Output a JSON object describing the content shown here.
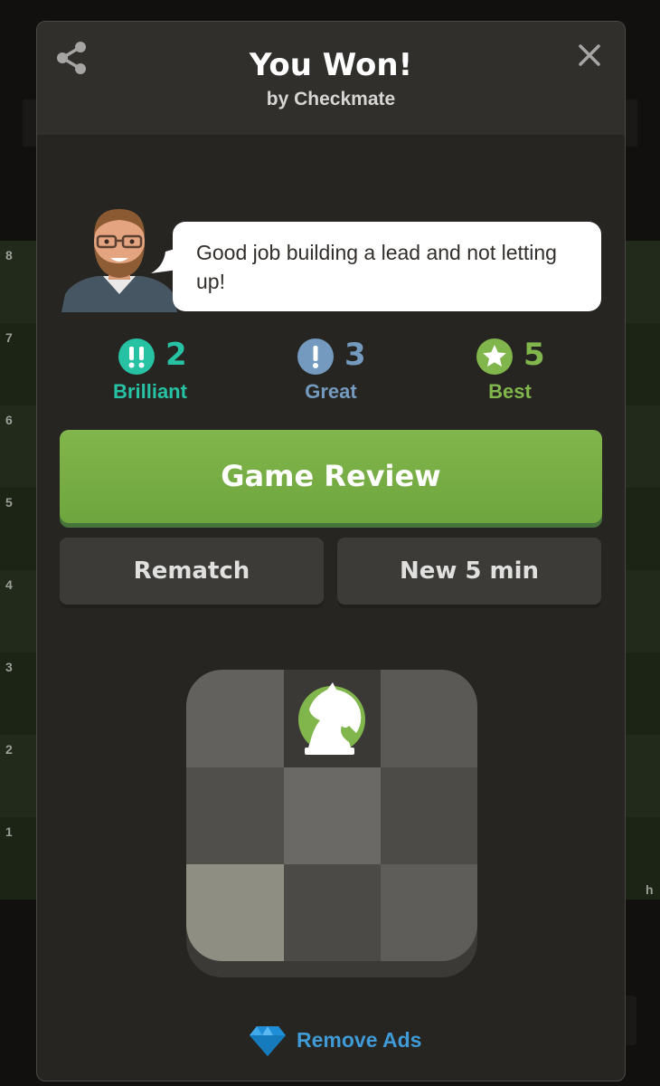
{
  "board": {
    "rank_labels": [
      "8",
      "7",
      "6",
      "5",
      "4",
      "3",
      "2",
      "1"
    ],
    "file_label": "h",
    "light_square": "#4a5a3c",
    "dark_square": "#3a4a2e"
  },
  "modal": {
    "title": "You Won!",
    "subtitle": "by Checkmate",
    "share_icon": "share-icon",
    "close_icon": "close-icon"
  },
  "coach": {
    "avatar": "coach-avatar",
    "message": "Good job building a lead and not letting up!"
  },
  "stats": [
    {
      "label": "Brilliant",
      "count": "2",
      "symbol": "!!",
      "color": "#26c2a3"
    },
    {
      "label": "Great",
      "count": "3",
      "symbol": "!",
      "color": "#749bbf"
    },
    {
      "label": "Best",
      "count": "5",
      "symbol": "★",
      "color": "#81b64c"
    }
  ],
  "buttons": {
    "game_review": "Game Review",
    "rematch": "Rematch",
    "new_game": "New 5 min"
  },
  "footer": {
    "remove_ads": "Remove Ads",
    "gem_icon": "diamond-icon"
  },
  "colors": {
    "accent_green": "#81b64c",
    "link_blue": "#3f9ad5"
  }
}
